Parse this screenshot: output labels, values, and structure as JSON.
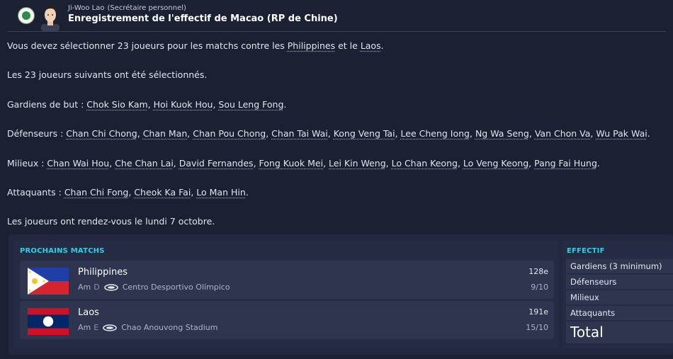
{
  "header": {
    "sender_name": "Ji-Woo Lao",
    "sender_role": "(Secrétaire personnel)",
    "title": "Enregistrement de l'effectif de Macao (RP de Chine)",
    "club_badge_icon": "club-crest-icon"
  },
  "message": {
    "intro": {
      "before": "Vous devez sélectionner 23 joueurs pour les matchs contre les ",
      "team1": "Philippines",
      "middle": " et le ",
      "team2": "Laos",
      "after": "."
    },
    "selected_line": "Les 23 joueurs suivants ont été sélectionnés.",
    "goalkeepers": {
      "label": "Gardiens de but : ",
      "players": [
        "Chok Sio Kam",
        "Hoi Kuok Hou",
        "Sou Leng Fong"
      ]
    },
    "defenders": {
      "label": "Défenseurs : ",
      "players": [
        "Chan Chi Chong",
        "Chan Man",
        "Chan Pou Chong",
        "Chan Tai Wai",
        "Kong Veng Tai",
        "Lee Cheng Iong",
        "Ng Wa Seng",
        "Van Chon Va",
        "Wu Pak Wai"
      ]
    },
    "midfielders": {
      "label": "Milieux : ",
      "players": [
        "Chan Wai Hou",
        "Che Chan Lai",
        "David Fernandes",
        "Fong Kuok Mei",
        "Lei Kin Weng",
        "Lo Chan Keong",
        "Lo Veng Keong",
        "Pang Fai Hung"
      ]
    },
    "attackers": {
      "label": "Attaquants : ",
      "players": [
        "Chan Chi Fong",
        "Cheok Ka Fai",
        "Lo Man Hin"
      ]
    },
    "meeting_line": "Les joueurs ont rendez-vous le lundi 7 octobre."
  },
  "upcoming": {
    "title": "PROCHAINS MATCHS",
    "matches": [
      {
        "team": "Philippines",
        "type": "Am",
        "venue_code": "D",
        "stadium": "Centro Desportivo Olímpico",
        "rank": "128e",
        "date": "9/10",
        "flag_icon": "philippines-flag-icon"
      },
      {
        "team": "Laos",
        "type": "Am",
        "venue_code": "E",
        "stadium": "Chao Anouvong Stadium",
        "rank": "191e",
        "date": "15/10",
        "flag_icon": "laos-flag-icon"
      }
    ]
  },
  "squad": {
    "title": "EFFECTIF",
    "rows": [
      "Gardiens (3 minimum)",
      "Défenseurs",
      "Milieux",
      "Attaquants"
    ],
    "total_label": "Total"
  },
  "colors": {
    "background": "#1c2033",
    "accent": "#29d1e8",
    "row": "#2f354f"
  }
}
